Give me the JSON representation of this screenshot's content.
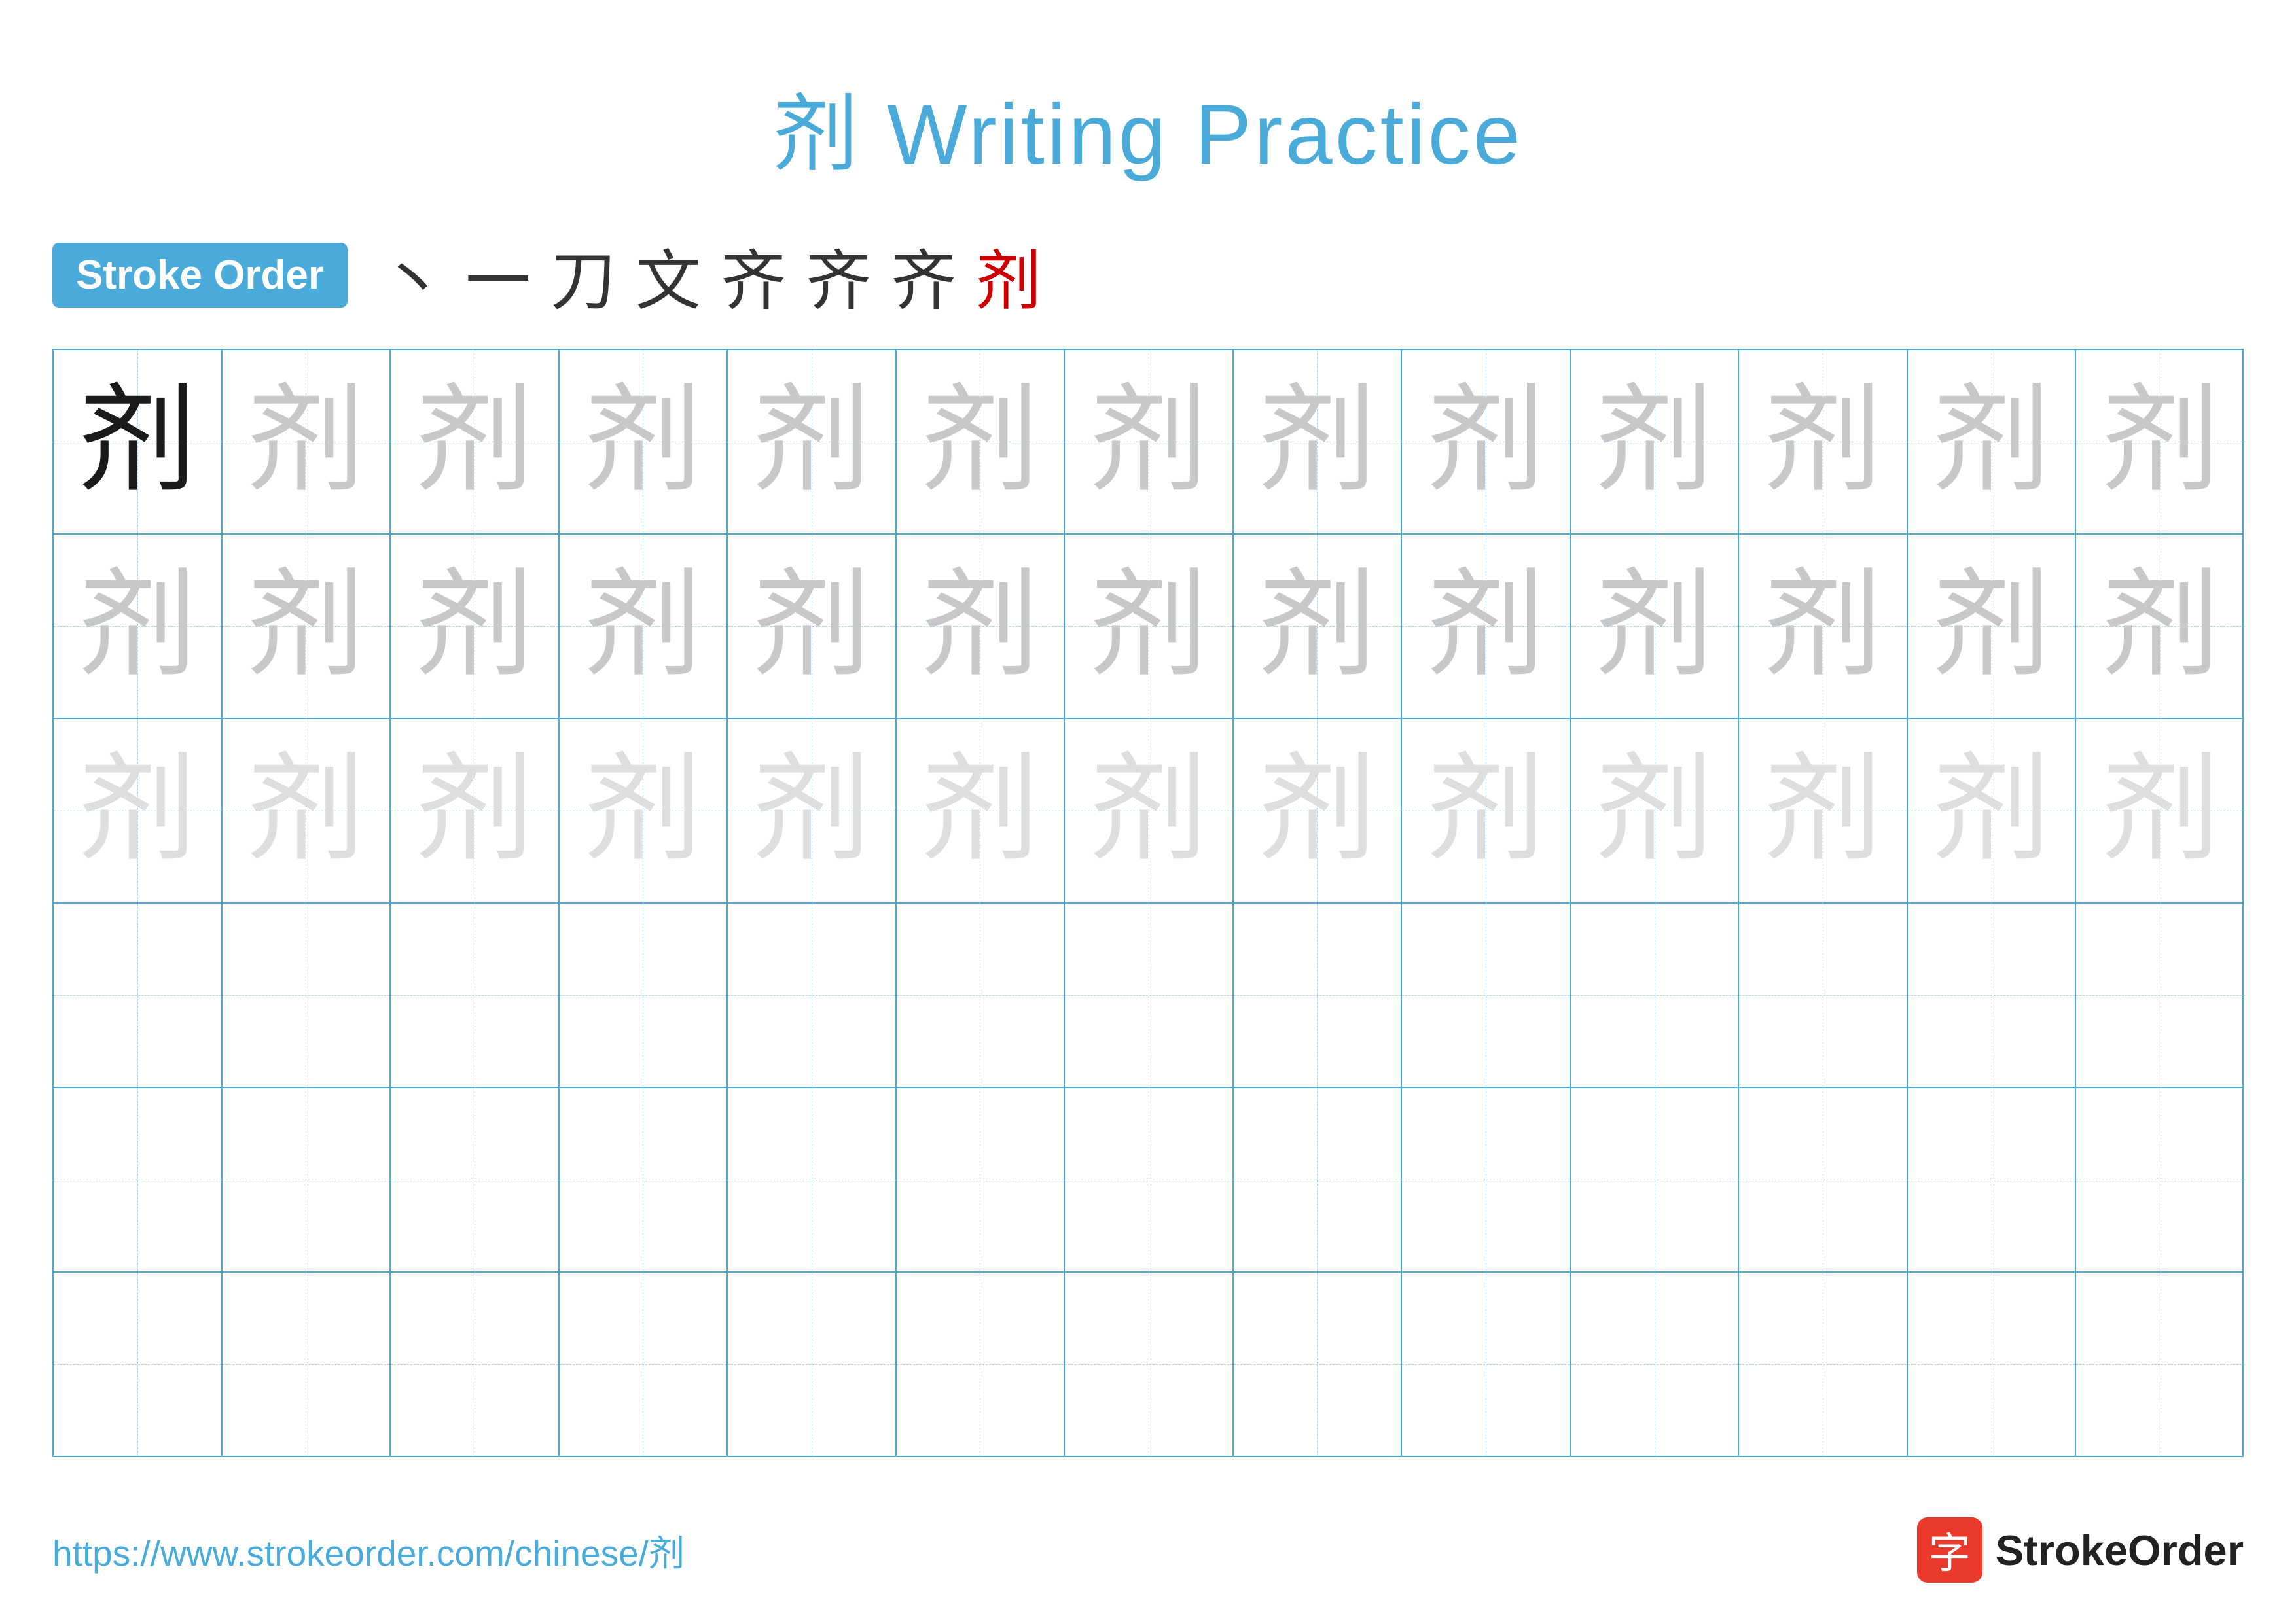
{
  "page": {
    "title": "剂 Writing Practice",
    "title_char": "剂",
    "title_suffix": " Writing Practice"
  },
  "stroke_order": {
    "badge_label": "Stroke Order",
    "strokes": [
      "丶",
      "一",
      "ㄏ",
      "文",
      "齐",
      "齐",
      "齐",
      "剂"
    ],
    "last_stroke_color": "red"
  },
  "grid": {
    "rows": 6,
    "cols": 13,
    "char": "剂",
    "row_types": [
      "dark-medium-medium",
      "medium",
      "light",
      "empty",
      "empty",
      "empty"
    ]
  },
  "footer": {
    "url": "https://www.strokeorder.com/chinese/剂",
    "logo_char": "字",
    "logo_text": "StrokeOrder"
  }
}
